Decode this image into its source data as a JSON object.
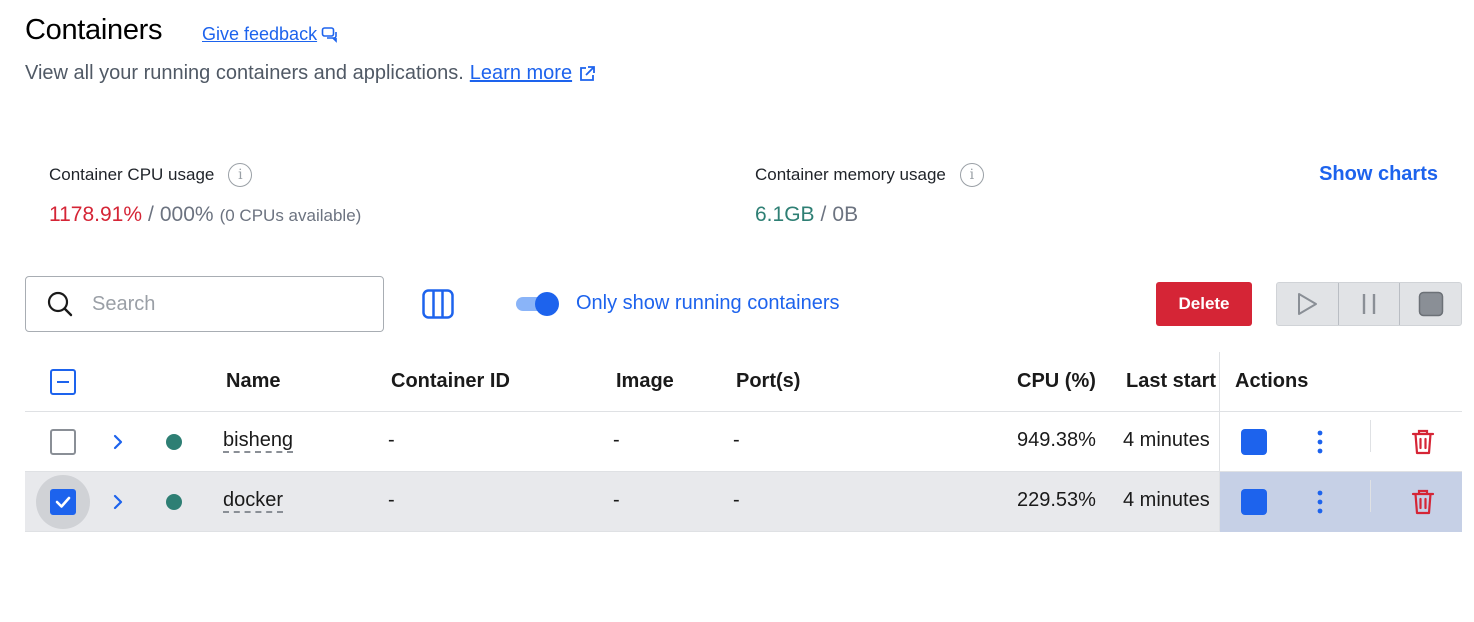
{
  "header": {
    "title": "Containers",
    "feedback_label": "Give feedback",
    "subtitle": "View all your running containers and applications.",
    "learn_more_label": "Learn more"
  },
  "stats": {
    "cpu": {
      "label": "Container CPU usage",
      "used": "1178.91%",
      "separator": "/",
      "total": "000%",
      "note": "(0 CPUs available)"
    },
    "memory": {
      "label": "Container memory usage",
      "used": "6.1GB",
      "separator": "/",
      "total": "0B"
    },
    "show_charts_label": "Show charts"
  },
  "toolbar": {
    "search_placeholder": "Search",
    "toggle_label": "Only show running containers",
    "toggle_on": true,
    "delete_label": "Delete"
  },
  "table": {
    "columns": [
      "Name",
      "Container ID",
      "Image",
      "Port(s)",
      "CPU (%)",
      "Last start",
      "Actions"
    ],
    "rows": [
      {
        "name": "bisheng",
        "container_id": "-",
        "image": "-",
        "ports": "-",
        "cpu": "949.38%",
        "last_started": "4 minutes",
        "selected": false,
        "status": "running"
      },
      {
        "name": "docker",
        "container_id": "-",
        "image": "-",
        "ports": "-",
        "cpu": "229.53%",
        "last_started": "4 minutes",
        "selected": true,
        "status": "running"
      }
    ]
  },
  "colors": {
    "accent": "#1d63ed",
    "danger": "#d52536",
    "running": "#2e7f74",
    "selected_row": "#e8e9ec",
    "selected_actions": "#c6d0e6"
  },
  "icons": {
    "feedback": "feedback-icon",
    "external_link": "external-link-icon",
    "info": "info-icon",
    "search": "search-icon",
    "columns": "columns-icon",
    "play": "play-icon",
    "pause": "pause-icon",
    "stop": "stop-icon",
    "expand": "chevron-right-icon",
    "more": "more-vertical-icon",
    "trash": "trash-icon"
  }
}
